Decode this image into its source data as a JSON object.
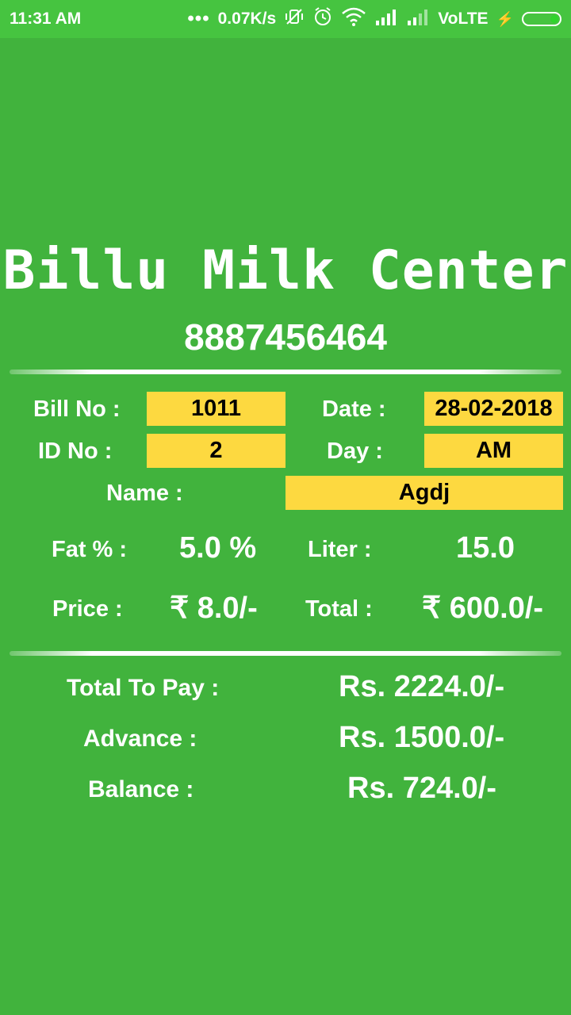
{
  "status_bar": {
    "time": "11:31 AM",
    "network_speed": "0.07K/s",
    "network_type": "VoLTE",
    "icons": [
      "more-dots-icon",
      "vibrate-off-icon",
      "alarm-icon",
      "wifi-icon",
      "signal-icon",
      "signal-icon",
      "charging-bolt-icon",
      "battery-icon"
    ]
  },
  "header": {
    "title": "Billu Milk Center",
    "phone": "8887456464"
  },
  "bill": {
    "bill_no_label": "Bill No :",
    "bill_no": "1011",
    "date_label": "Date :",
    "date": "28-02-2018",
    "id_no_label": "ID No :",
    "id_no": "2",
    "day_label": "Day :",
    "day": "AM",
    "name_label": "Name :",
    "name": "Agdj"
  },
  "measure": {
    "fat_label": "Fat % :",
    "fat_value": "5.0 %",
    "liter_label": "Liter :",
    "liter_value": "15.0",
    "price_label": "Price :",
    "price_value": "₹ 8.0/-",
    "total_label": "Total :",
    "total_value": "₹ 600.0/-"
  },
  "summary": {
    "total_to_pay_label": "Total To Pay :",
    "total_to_pay_value": "Rs. 2224.0/-",
    "advance_label": "Advance :",
    "advance_value": "Rs. 1500.0/-",
    "balance_label": "Balance :",
    "balance_value": "Rs. 724.0/-"
  },
  "colors": {
    "background": "#41b33d",
    "status_bar": "#46c440",
    "field_box": "#fdd940"
  }
}
